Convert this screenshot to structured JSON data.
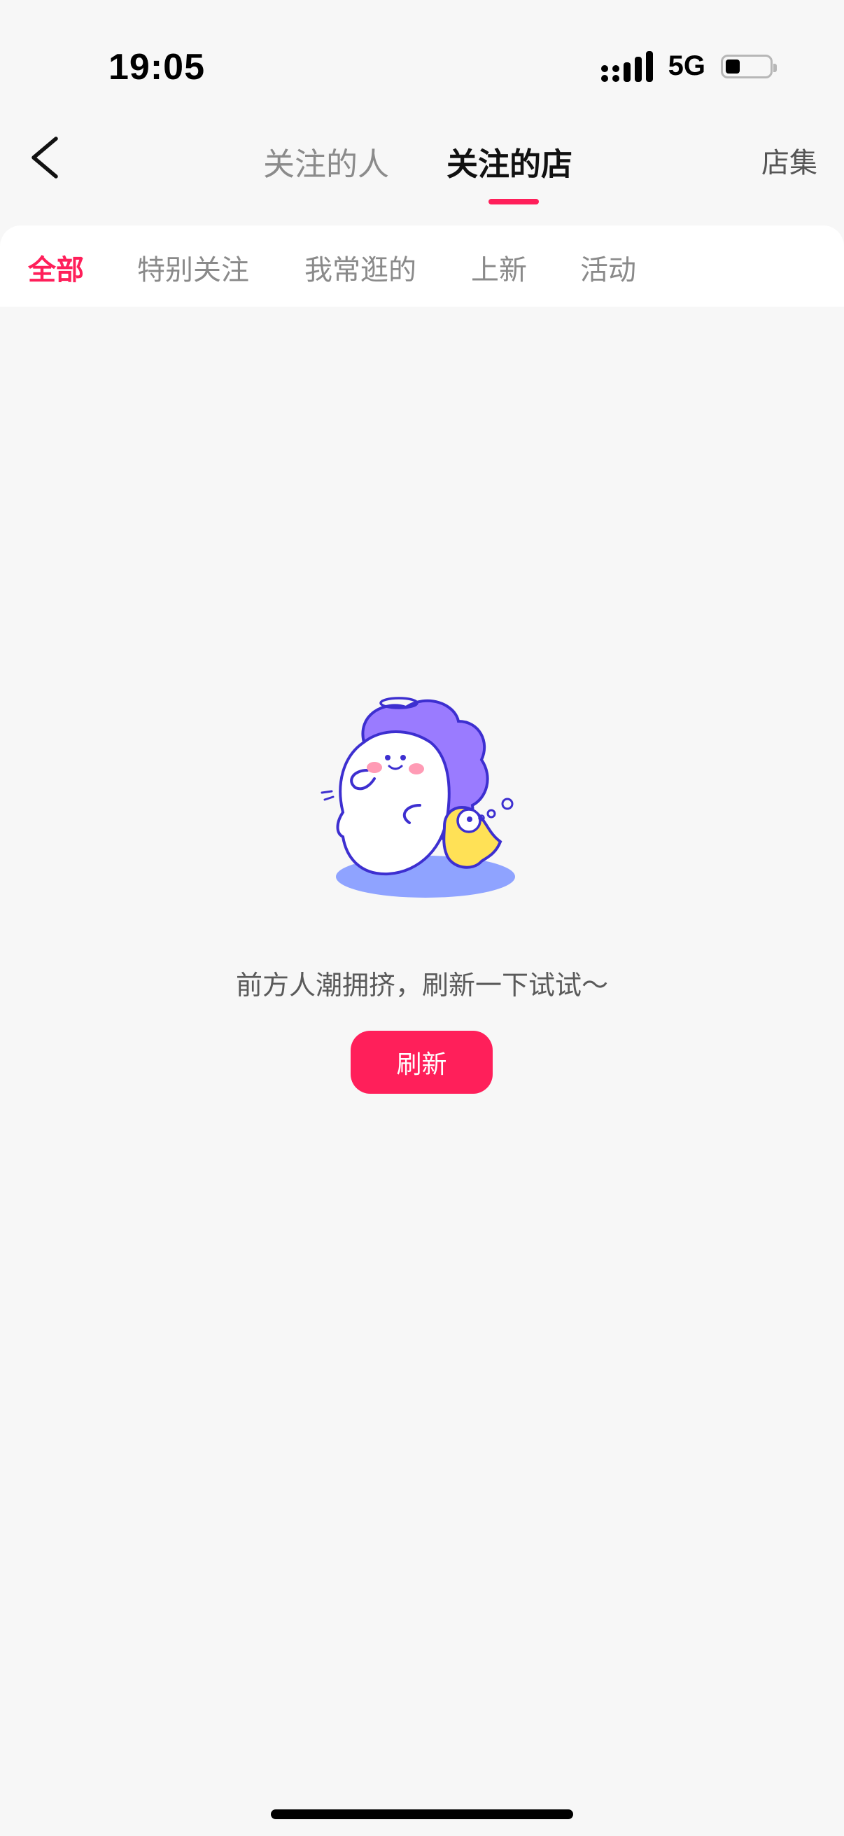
{
  "status": {
    "time": "19:05",
    "network": "5G"
  },
  "header": {
    "tabs": [
      {
        "label": "关注的人",
        "active": false
      },
      {
        "label": "关注的店",
        "active": true
      }
    ],
    "right_label": "店集"
  },
  "subtabs": [
    {
      "label": "全部",
      "active": true
    },
    {
      "label": "特别关注",
      "active": false
    },
    {
      "label": "我常逛的",
      "active": false
    },
    {
      "label": "上新",
      "active": false
    },
    {
      "label": "活动",
      "active": false
    }
  ],
  "empty": {
    "message": "前方人潮拥挤，刷新一下试试～",
    "button_label": "刷新"
  },
  "colors": {
    "accent": "#ff1f5a",
    "background": "#f7f7f7"
  }
}
